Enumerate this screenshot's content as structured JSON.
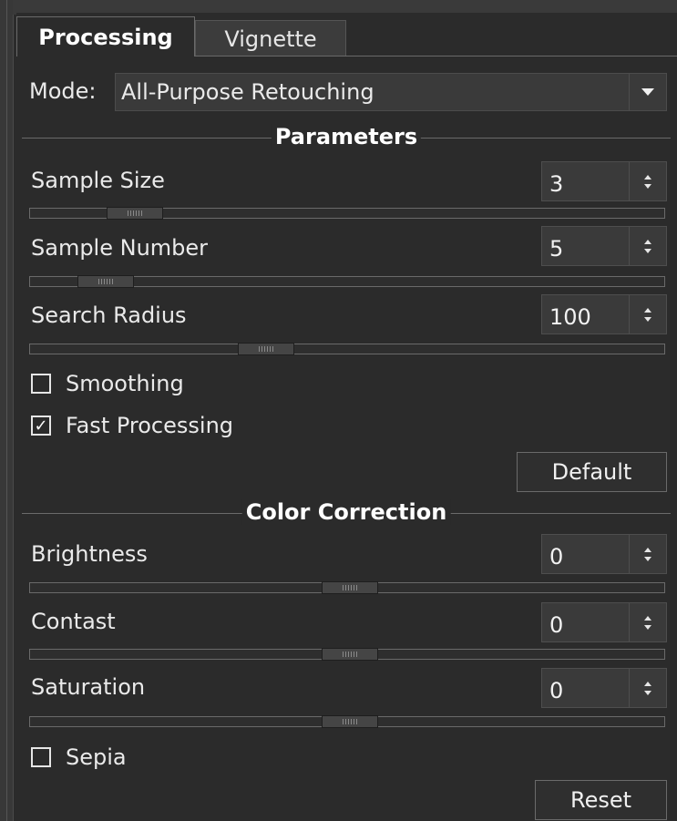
{
  "tabs": [
    {
      "label": "Processing",
      "active": true
    },
    {
      "label": "Vignette",
      "active": false
    }
  ],
  "mode": {
    "label": "Mode:",
    "value": "All-Purpose Retouching",
    "arrow_icon": "chevron-down-icon"
  },
  "parameters": {
    "title": "Parameters",
    "sample_size": {
      "label": "Sample Size",
      "value": "3",
      "slider_level": 0.14
    },
    "sample_number": {
      "label": "Sample Number",
      "value": "5",
      "slider_level": 0.08
    },
    "search_radius": {
      "label": "Search Radius",
      "value": "100",
      "slider_level": 0.38
    },
    "smoothing": {
      "label": "Smoothing",
      "checked": false
    },
    "fast_processing": {
      "label": "Fast Processing",
      "checked": true
    },
    "default_button": "Default"
  },
  "color_correction": {
    "title": "Color Correction",
    "brightness": {
      "label": "Brightness",
      "value": "0",
      "slider_level": 0.5
    },
    "contrast": {
      "label": "Contast",
      "value": "0",
      "slider_level": 0.5
    },
    "saturation": {
      "label": "Saturation",
      "value": "0",
      "slider_level": 0.5
    },
    "sepia": {
      "label": "Sepia",
      "checked": false
    },
    "reset_button": "Reset"
  },
  "colors": {
    "background": "#2b2b2b",
    "field": "#3a3a3a",
    "text": "#eaeaea"
  }
}
